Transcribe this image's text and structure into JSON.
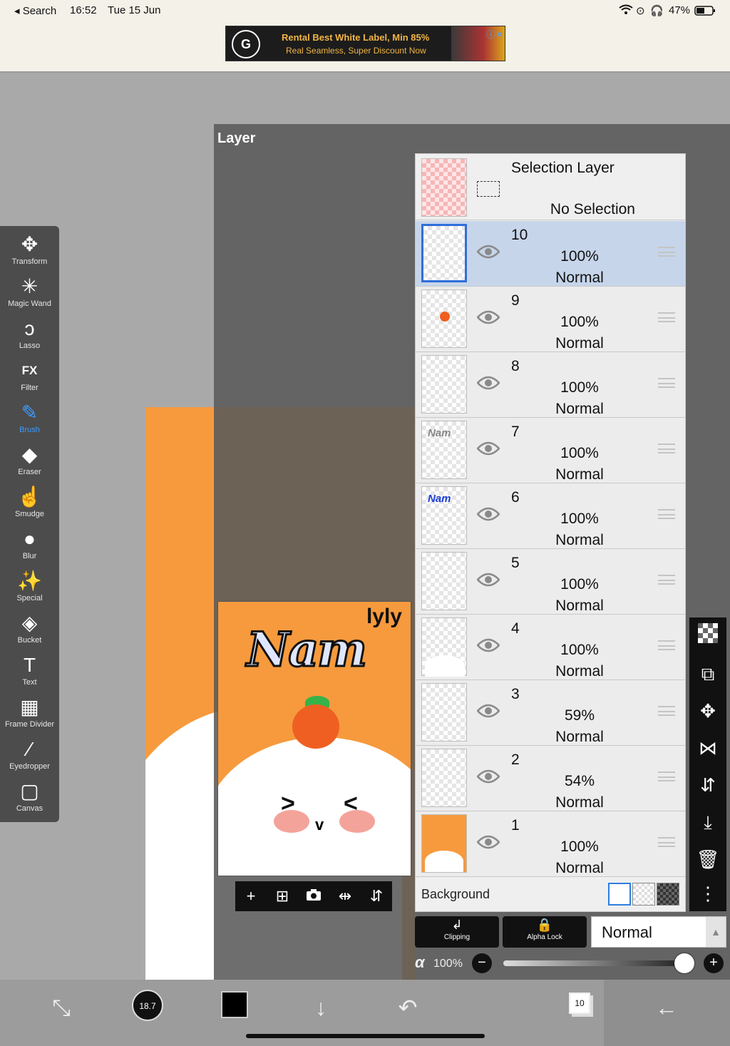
{
  "status_bar": {
    "back_label": "◂ Search",
    "time": "16:52",
    "date": "Tue 15 Jun",
    "battery": "47%"
  },
  "ad": {
    "logo": "G",
    "line1": "Rental Best White Label, Min 85%",
    "line2": "Real Seamless, Super Discount Now"
  },
  "panel": {
    "title": "Layer"
  },
  "artwork": {
    "title": "Nam",
    "signature": "lyly",
    "eye_left": ">",
    "eye_right": "<",
    "mouth": "v"
  },
  "tools": [
    {
      "label": "Transform",
      "icon": "move-icon",
      "glyph": "✥"
    },
    {
      "label": "Magic Wand",
      "icon": "magic-wand-icon",
      "glyph": "✳"
    },
    {
      "label": "Lasso",
      "icon": "lasso-icon",
      "glyph": "ↄ"
    },
    {
      "label": "Filter",
      "icon": "fx-icon",
      "glyph": "FX"
    },
    {
      "label": "Brush",
      "icon": "brush-icon",
      "glyph": "✎"
    },
    {
      "label": "Eraser",
      "icon": "eraser-icon",
      "glyph": "◆"
    },
    {
      "label": "Smudge",
      "icon": "smudge-icon",
      "glyph": "☝"
    },
    {
      "label": "Blur",
      "icon": "blur-drop-icon",
      "glyph": "●"
    },
    {
      "label": "Special",
      "icon": "special-wand-icon",
      "glyph": "✨"
    },
    {
      "label": "Bucket",
      "icon": "bucket-icon",
      "glyph": "◈"
    },
    {
      "label": "Text",
      "icon": "text-icon",
      "glyph": "T"
    },
    {
      "label": "Frame Divider",
      "icon": "frame-divider-icon",
      "glyph": "▦"
    },
    {
      "label": "Eyedropper",
      "icon": "eyedropper-icon",
      "glyph": "⁄"
    },
    {
      "label": "Canvas",
      "icon": "canvas-icon",
      "glyph": "▢"
    }
  ],
  "active_tool": "Brush",
  "selection_layer": {
    "title": "Selection Layer",
    "subtitle": "No Selection"
  },
  "layers": [
    {
      "number": "10",
      "opacity": "100%",
      "mode": "Normal",
      "selected": true
    },
    {
      "number": "9",
      "opacity": "100%",
      "mode": "Normal",
      "selected": false
    },
    {
      "number": "8",
      "opacity": "100%",
      "mode": "Normal",
      "selected": false
    },
    {
      "number": "7",
      "opacity": "100%",
      "mode": "Normal",
      "selected": false
    },
    {
      "number": "6",
      "opacity": "100%",
      "mode": "Normal",
      "selected": false
    },
    {
      "number": "5",
      "opacity": "100%",
      "mode": "Normal",
      "selected": false
    },
    {
      "number": "4",
      "opacity": "100%",
      "mode": "Normal",
      "selected": false
    },
    {
      "number": "3",
      "opacity": "59%",
      "mode": "Normal",
      "selected": false
    },
    {
      "number": "2",
      "opacity": "54%",
      "mode": "Normal",
      "selected": false
    },
    {
      "number": "1",
      "opacity": "100%",
      "mode": "Normal",
      "selected": false
    }
  ],
  "background": {
    "label": "Background"
  },
  "controls": {
    "clipping": "Clipping",
    "alpha_lock": "Alpha Lock",
    "blend_mode": "Normal",
    "alpha_symbol": "α",
    "opacity": "100%",
    "opacity_fraction": 1.0
  },
  "bottom_bar": {
    "brush_size": "18.7",
    "layer_count": "10",
    "color": "#000000"
  }
}
